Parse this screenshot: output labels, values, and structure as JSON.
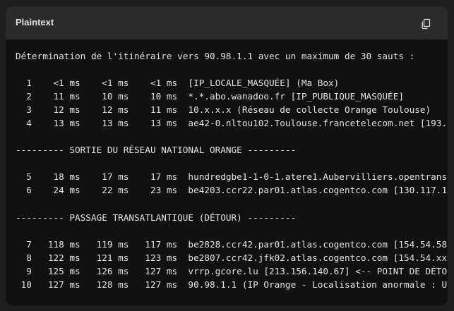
{
  "header": {
    "title": "Plaintext",
    "copy_icon": "copy-icon"
  },
  "code_lines": [
    "Détermination de l'itinéraire vers 90.98.1.1 avec un maximum de 30 sauts :",
    "",
    "  1    <1 ms    <1 ms    <1 ms  [IP_LOCALE_MASQUÉE] (Ma Box)",
    "  2    11 ms    10 ms    10 ms  *.*.abo.wanadoo.fr [IP_PUBLIQUE_MASQUÉE]",
    "  3    12 ms    12 ms    11 ms  10.x.x.x (Réseau de collecte Orange Toulouse)",
    "  4    13 ms    13 ms    13 ms  ae42-0.nltou102.Toulouse.francetelecom.net [193.2",
    "",
    "--------- SORTIE DU RÉSEAU NATIONAL ORANGE ---------",
    "",
    "  5    18 ms    17 ms    17 ms  hundredgbe1-1-0-1.atere1.Aubervilliers.opentransi",
    "  6    24 ms    22 ms    23 ms  be4203.ccr22.par01.atlas.cogentco.com [130.117.1.",
    "",
    "--------- PASSAGE TRANSATLANTIQUE (DÉTOUR) ---------",
    "",
    "  7   118 ms   119 ms   117 ms  be2828.ccr42.par01.atlas.cogentco.com [154.54.58.",
    "  8   122 ms   121 ms   123 ms  be2807.ccr42.jfk02.atlas.cogentco.com [154.54.xx.",
    "  9   125 ms   126 ms   127 ms  vrrp.gcore.lu [213.156.140.67] <-- POINT DE DÉTOU",
    " 10   127 ms   128 ms   127 ms  90.98.1.1 (IP Orange - Localisation anormale : US"
  ]
}
